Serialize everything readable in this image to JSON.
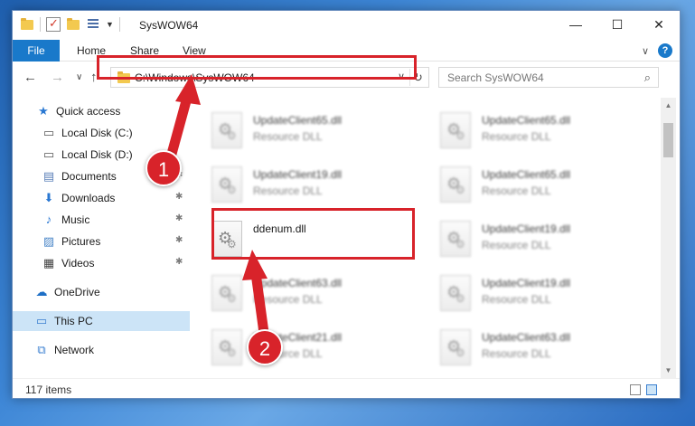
{
  "window": {
    "title": "SysWOW64",
    "minimize_glyph": "—",
    "maximize_glyph": "☐",
    "close_glyph": "✕"
  },
  "ribbon": {
    "tabs": [
      "File",
      "Home",
      "Share",
      "View"
    ],
    "help": "?",
    "expand": "∨"
  },
  "nav": {
    "back": "←",
    "forward": "→",
    "recent": "∨",
    "up": "↑"
  },
  "address": {
    "path": "C:\\Windows\\SysWOW64",
    "dropdown": "∨",
    "refresh": "↻"
  },
  "search": {
    "placeholder": "Search SysWOW64",
    "icon": "⌕"
  },
  "sidebar": {
    "items": [
      {
        "label": "Quick access",
        "icon": "★",
        "pinned": false
      },
      {
        "label": "Local Disk (C:)",
        "icon": "▭",
        "pinned": false
      },
      {
        "label": "Local Disk (D:)",
        "icon": "▭",
        "pinned": false
      },
      {
        "label": "Documents",
        "icon": "▤",
        "pinned": true
      },
      {
        "label": "Downloads",
        "icon": "⬇",
        "pinned": true
      },
      {
        "label": "Music",
        "icon": "♪",
        "pinned": true
      },
      {
        "label": "Pictures",
        "icon": "▨",
        "pinned": true
      },
      {
        "label": "Videos",
        "icon": "▦",
        "pinned": true
      },
      {
        "label": "OneDrive",
        "icon": "☁",
        "pinned": false
      },
      {
        "label": "This PC",
        "icon": "▭",
        "pinned": false
      },
      {
        "label": "Network",
        "icon": "⧉",
        "pinned": false
      }
    ],
    "pin_glyph": "📌"
  },
  "files": {
    "left": [
      {
        "name": "UpdateClient65.dll",
        "type": "Resource DLL"
      },
      {
        "name": "UpdateClient19.dll",
        "type": "Resource DLL"
      },
      {
        "name": "ddenum.dll",
        "type": ""
      },
      {
        "name": "UpdateClient63.dll",
        "type": "Resource DLL"
      },
      {
        "name": "UpdateClient21.dll",
        "type": "Resource DLL"
      }
    ],
    "right": [
      {
        "name": "UpdateClient65.dll",
        "type": "Resource DLL"
      },
      {
        "name": "UpdateClient65.dll",
        "type": "Resource DLL"
      },
      {
        "name": "UpdateClient19.dll",
        "type": "Resource DLL"
      },
      {
        "name": "UpdateClient19.dll",
        "type": "Resource DLL"
      },
      {
        "name": "UpdateClient63.dll",
        "type": "Resource DLL"
      }
    ]
  },
  "status": {
    "item_count": "117 items"
  },
  "annotations": {
    "step1": "1",
    "step2": "2",
    "color": "#d8232a"
  }
}
